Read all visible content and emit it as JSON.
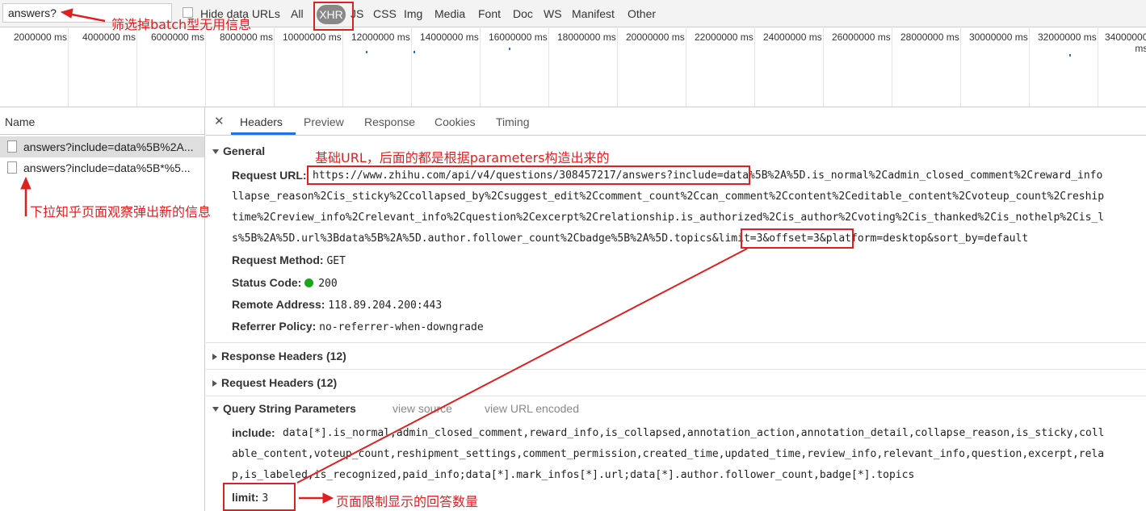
{
  "toolbar": {
    "filter_value": "answers?",
    "hide_data_urls": "Hide data URLs",
    "types": [
      "All",
      "XHR",
      "JS",
      "CSS",
      "Img",
      "Media",
      "Font",
      "Doc",
      "WS",
      "Manifest",
      "Other"
    ],
    "selected_type": "XHR"
  },
  "overview": {
    "ticks": [
      "2000000 ms",
      "4000000 ms",
      "6000000 ms",
      "8000000 ms",
      "10000000 ms",
      "12000000 ms",
      "14000000 ms",
      "16000000 ms",
      "18000000 ms",
      "20000000 ms",
      "22000000 ms",
      "24000000 ms",
      "26000000 ms",
      "28000000 ms",
      "30000000 ms",
      "32000000 ms",
      "34000000 ms"
    ]
  },
  "request_list": {
    "header": "Name",
    "items": [
      {
        "name": "answers?include=data%5B%2A..."
      },
      {
        "name": "answers?include=data%5B*%5..."
      }
    ]
  },
  "detail_tabs": [
    "Headers",
    "Preview",
    "Response",
    "Cookies",
    "Timing"
  ],
  "active_tab": "Headers",
  "general": {
    "title": "General",
    "request_url_label": "Request URL:",
    "request_url_lines": [
      "https://www.zhihu.com/api/v4/questions/308457217/answers?include=data%5B%2A%5D.is_normal%2Cadmin_closed_comment%2Creward_info",
      "llapse_reason%2Cis_sticky%2Ccollapsed_by%2Csuggest_edit%2Ccomment_count%2Ccan_comment%2Ccontent%2Ceditable_content%2Cvoteup_count%2Creship",
      "time%2Creview_info%2Crelevant_info%2Cquestion%2Cexcerpt%2Crelationship.is_authorized%2Cis_author%2Cvoting%2Cis_thanked%2Cis_nothelp%2Cis_l",
      "s%5B%2A%5D.url%3Bdata%5B%2A%5D.author.follower_count%2Cbadge%5B%2A%5D.topics&limit=3&offset=3&platform=desktop&sort_by=default"
    ],
    "request_method_label": "Request Method:",
    "request_method": "GET",
    "status_code_label": "Status Code:",
    "status_code": "200",
    "remote_address_label": "Remote Address:",
    "remote_address": "118.89.204.200:443",
    "referrer_policy_label": "Referrer Policy:",
    "referrer_policy": "no-referrer-when-downgrade"
  },
  "response_headers": "Response Headers (12)",
  "request_headers": "Request Headers (12)",
  "query_params": {
    "title": "Query String Parameters",
    "view_source": "view source",
    "view_url_encoded": "view URL encoded",
    "include_label": "include:",
    "include_lines": [
      "data[*].is_normal,admin_closed_comment,reward_info,is_collapsed,annotation_action,annotation_detail,collapse_reason,is_sticky,coll",
      "able_content,voteup_count,reshipment_settings,comment_permission,created_time,updated_time,review_info,relevant_info,question,excerpt,rela",
      "p,is_labeled,is_recognized,paid_info;data[*].mark_infos[*].url;data[*].author.follower_count,badge[*].topics"
    ],
    "limit_label": "limit:",
    "limit_value": "3"
  },
  "annotations": {
    "filter_note": "筛选掉batch型无用信息",
    "scroll_note": "下拉知乎页面观察弹出新的信息",
    "url_note": "基础URL，后面的都是根据parameters构造出来的",
    "limit_note": "页面限制显示的回答数量"
  },
  "colors": {
    "annotation_red": "#e02020",
    "status_green": "#1aa51a",
    "tab_underline": "#1a73e8"
  }
}
